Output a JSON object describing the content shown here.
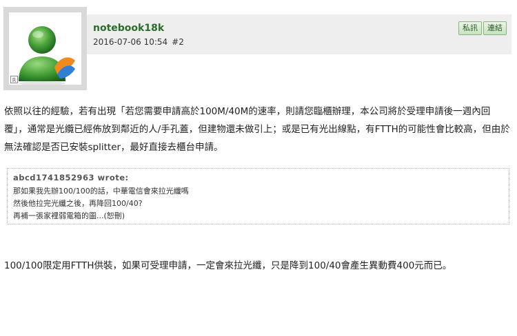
{
  "user": {
    "name": "notebook18k",
    "avatar_badge": "R"
  },
  "post": {
    "date": "2016-07-06 10:54",
    "number": "#2"
  },
  "buttons": {
    "pm": "私訊",
    "link": "連結"
  },
  "content": {
    "paragraph1": "依照以往的經驗，若有出現「若您需要申請高於100M/40M的速率，則請您臨櫃辦理，本公司將於受理申請後一週內回覆」，通常是光纜已經佈放到鄰近的人/手孔蓋，但建物還未做引上；或是已有光出線點，有FTTH的可能性會比較高，但由於無法確認是否已安裝splitter，最好直接去櫃台申請。",
    "paragraph2": "100/100限定用FTTH供裝，如果可受理申請，一定會來拉光纖，只是降到100/40會產生異動費400元而已。"
  },
  "quote": {
    "author": "abcd1741852963 wrote:",
    "lines": [
      "那如果我先辦100/100的話，中華電信會來拉光纖嗎",
      "然後他拉完光纖之後，再降回100/40?",
      "再補一張家裡弱電箱的圖...(恕刪)"
    ]
  }
}
